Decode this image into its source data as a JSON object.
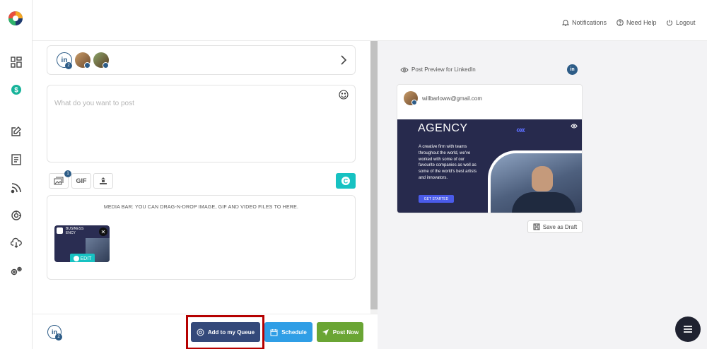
{
  "header": {
    "notifications": "Notifications",
    "help": "Need Help",
    "logout": "Logout"
  },
  "accounts": {
    "badge_count": "2"
  },
  "composer": {
    "placeholder": "What do you want to post"
  },
  "tools": {
    "image_badge": "1",
    "gif_label": "GIF"
  },
  "media": {
    "hint": "MEDIA BAR: YOU CAN DRAG-N-DROP IMAGE, GIF AND VIDEO FILES TO HERE.",
    "edit_label": "EDIT",
    "thumb_text": "BUSINESS\nENCY"
  },
  "actions": {
    "queue": "Add to my Queue",
    "schedule": "Schedule",
    "post_now": "Post Now",
    "account_badge": "2"
  },
  "preview": {
    "label": "Post Preview for LinkedIn",
    "email": "willbarloww@gmail.com",
    "ad_title": "AGENCY",
    "ad_body": "A creative firm with teams throughout the world, we've worked with some of our favourite companies as well as some of the world's best artists and innovators.",
    "ad_cta": "GET STARTED",
    "save_draft": "Save as Draft"
  },
  "colors": {
    "queue_btn": "#34497a",
    "schedule_btn": "#2f9ee6",
    "post_btn": "#6aa534",
    "linkedin": "#2d5c87",
    "teal": "#17c2c2"
  }
}
